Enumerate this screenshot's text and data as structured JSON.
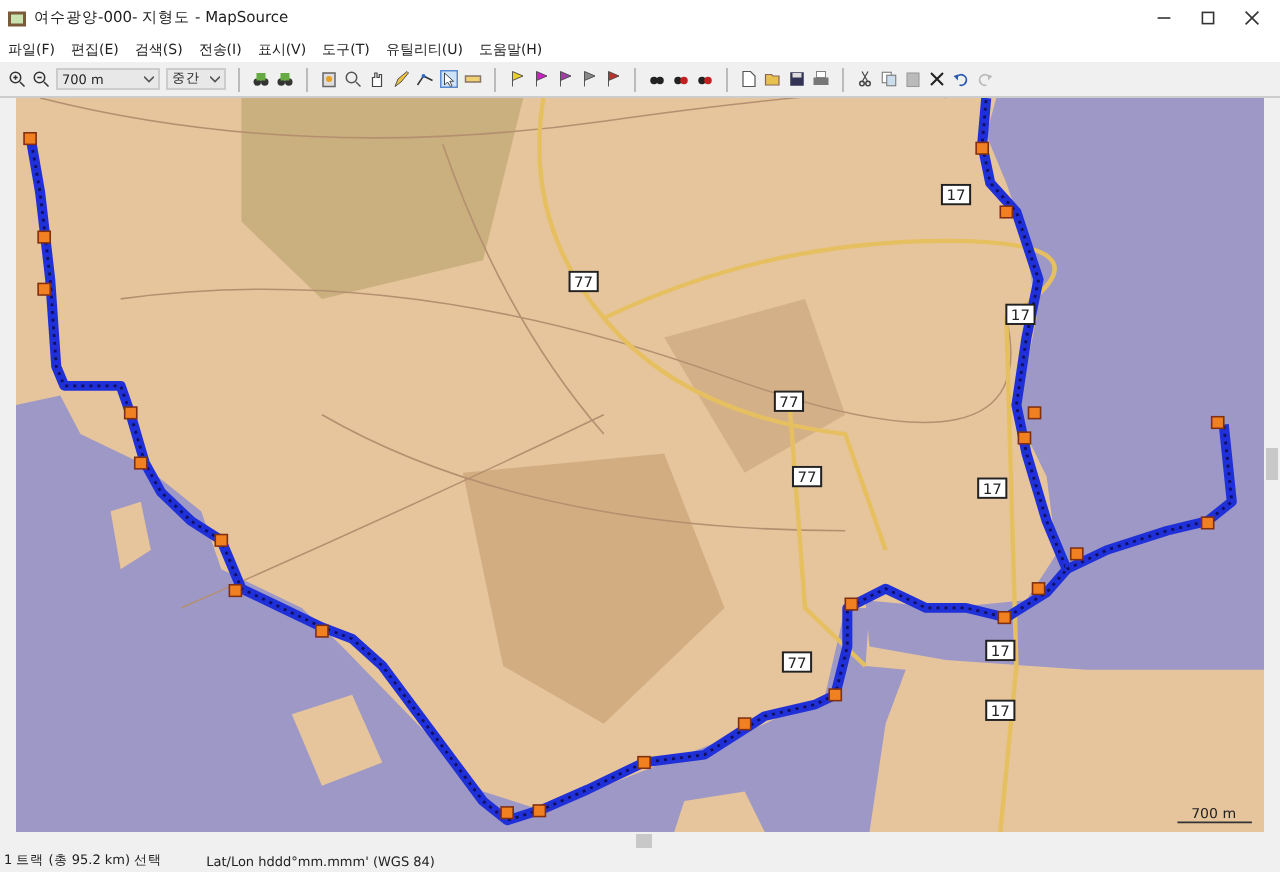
{
  "window": {
    "title": "여수광양-000- 지형도 - MapSource"
  },
  "menu": [
    "파일(F)",
    "편집(E)",
    "검색(S)",
    "전송(I)",
    "표시(V)",
    "도구(T)",
    "유틸리티(U)",
    "도움말(H)"
  ],
  "toolbar": {
    "zoom_scale": "700 m",
    "detail_level": "중간"
  },
  "map": {
    "road_shields": [
      "77",
      "17",
      "77",
      "77",
      "17",
      "17",
      "77",
      "17",
      "17"
    ],
    "scale": "700 m"
  },
  "status_bar": {
    "selection": "1 트랙 (총 95.2 km) 선택",
    "coordinates": "Lat/Lon hddd°mm.mmm' (WGS 84)"
  }
}
